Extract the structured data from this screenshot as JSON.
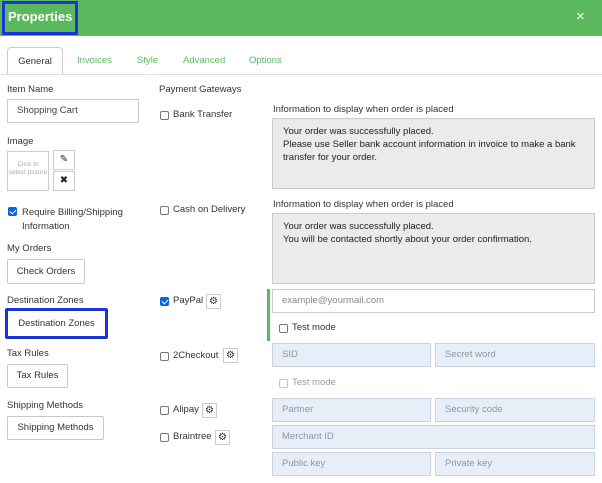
{
  "dialog": {
    "title": "Properties",
    "close_icon": "×"
  },
  "tabs": [
    {
      "label": "General"
    },
    {
      "label": "Invoices"
    },
    {
      "label": "Style"
    },
    {
      "label": "Advanced"
    },
    {
      "label": "Options"
    }
  ],
  "left": {
    "item_name_label": "Item Name",
    "item_name_value": "Shopping Cart",
    "image_label": "Image",
    "image_placeholder": "Click to select picture",
    "require_billing_label": "Require Billing/Shipping Information",
    "my_orders_label": "My Orders",
    "check_orders_button": "Check Orders",
    "destination_zones_label": "Destination Zones",
    "destination_zones_button": "Destination Zones",
    "tax_rules_label": "Tax Rules",
    "tax_rules_button": "Tax Rules",
    "shipping_methods_label": "Shipping Methods",
    "shipping_methods_button": "Shipping Methods"
  },
  "gateways": {
    "title": "Payment Gateways",
    "bank_transfer": "Bank Transfer",
    "cash_on_delivery": "Cash on Delivery",
    "paypal": "PayPal",
    "twocheckout": "2Checkout",
    "alipay": "Alipay",
    "braintree": "Braintree"
  },
  "right": {
    "bank_info_label": "Information to display when order is placed",
    "bank_info_text": "Your order was successfully placed.\nPlease use Seller bank account information in invoice to make a bank transfer for your order.",
    "cod_info_label": "Information to display when order is placed",
    "cod_info_text": "Your order was successfully placed.\nYou will be contacted shortly about your order confirmation.",
    "paypal_email_placeholder": "example@yourmail.com",
    "test_mode_label": "Test mode",
    "sid_placeholder": "SID",
    "secret_word_placeholder": "Secret word",
    "test_mode_label_2": "Test mode",
    "partner_placeholder": "Partner",
    "security_code_placeholder": "Security code",
    "merchant_id_placeholder": "Merchant ID",
    "public_key_placeholder": "Public key",
    "private_key_placeholder": "Private key"
  },
  "colors": {
    "header": "#5cb85c",
    "accent": "#5cb85c",
    "highlight": "#1a35d6",
    "checkbox": "#0b63d6"
  }
}
